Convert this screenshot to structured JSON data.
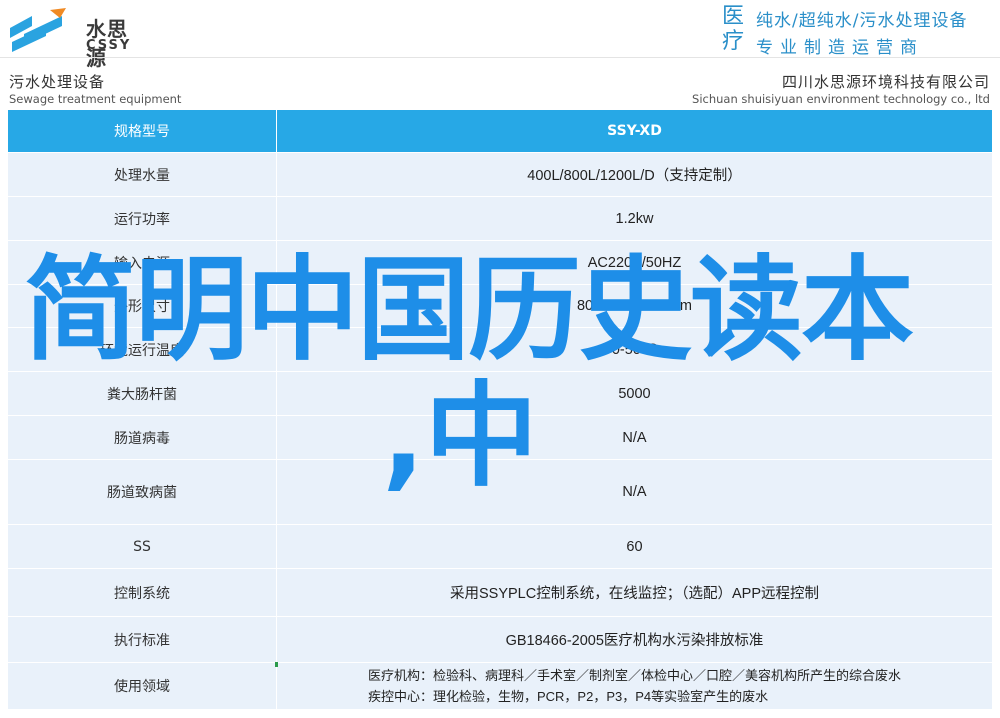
{
  "banner": {
    "logo_cn": "水思源",
    "logo_en": "CSSY",
    "slogan_big": "医疗",
    "slogan_line1": "纯水/超纯水/污水处理设备",
    "slogan_line2": "专业制造运营商"
  },
  "header": {
    "left_cn": "污水处理设备",
    "left_en": "Sewage treatment equipment",
    "right_cn": "四川水思源环境科技有限公司",
    "right_en": "Sichuan shuisiyuan environment technology co., ltd"
  },
  "table": {
    "header": {
      "label": "规格型号",
      "value": "SSY-XD"
    },
    "rows": [
      {
        "label": "处理水量",
        "value": "400L/800L/1200L/D（支持定制）"
      },
      {
        "label": "运行功率",
        "value": "1.2kw"
      },
      {
        "label": "输入电源",
        "value": "AC220V/50HZ"
      },
      {
        "label": "外形尺寸",
        "value": "800*460*1140mm"
      },
      {
        "label": "环境运行温度",
        "value": "0-50℃"
      },
      {
        "label": "粪大肠杆菌",
        "value": "5000"
      },
      {
        "label": "肠道病毒",
        "value": "N/A"
      },
      {
        "label": "肠道致病菌",
        "value": "N/A"
      },
      {
        "label": "SS",
        "value": "60"
      },
      {
        "label": "控制系统",
        "value": "采用SSYPLC控制系统，在线监控；（选配）APP远程控制"
      },
      {
        "label": "执行标准",
        "value": "GB18466-2005医疗机构水污染排放标准"
      },
      {
        "label": "使用领域",
        "value_line1": "医疗机构：检验科、病理科／手术室／制剂室／体检中心／口腔／美容机构所产生的综合废水",
        "value_line2": "疾控中心：理化检验，生物，PCR，P2，P3，P4等实验室产生的废水"
      }
    ]
  },
  "overlay": {
    "title": "简明中国历史读本",
    "subtitle": ",中"
  },
  "colors": {
    "accent": "#27a8e6",
    "row_bg": "#e9f1fa",
    "overlay_text": "#1e8ee8",
    "slogan": "#2a8fc9"
  }
}
